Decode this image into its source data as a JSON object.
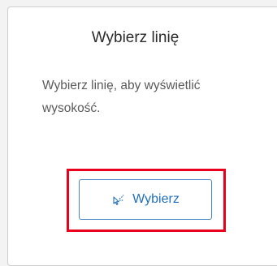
{
  "panel": {
    "title": "Wybierz linię",
    "description": "Wybierz linię, aby wyświetlić wysokość."
  },
  "select_button": {
    "label": "Wybierz",
    "icon": "select-line-cursor-icon"
  },
  "colors": {
    "accent": "#1f6fbd",
    "highlight": "#e8001c"
  }
}
